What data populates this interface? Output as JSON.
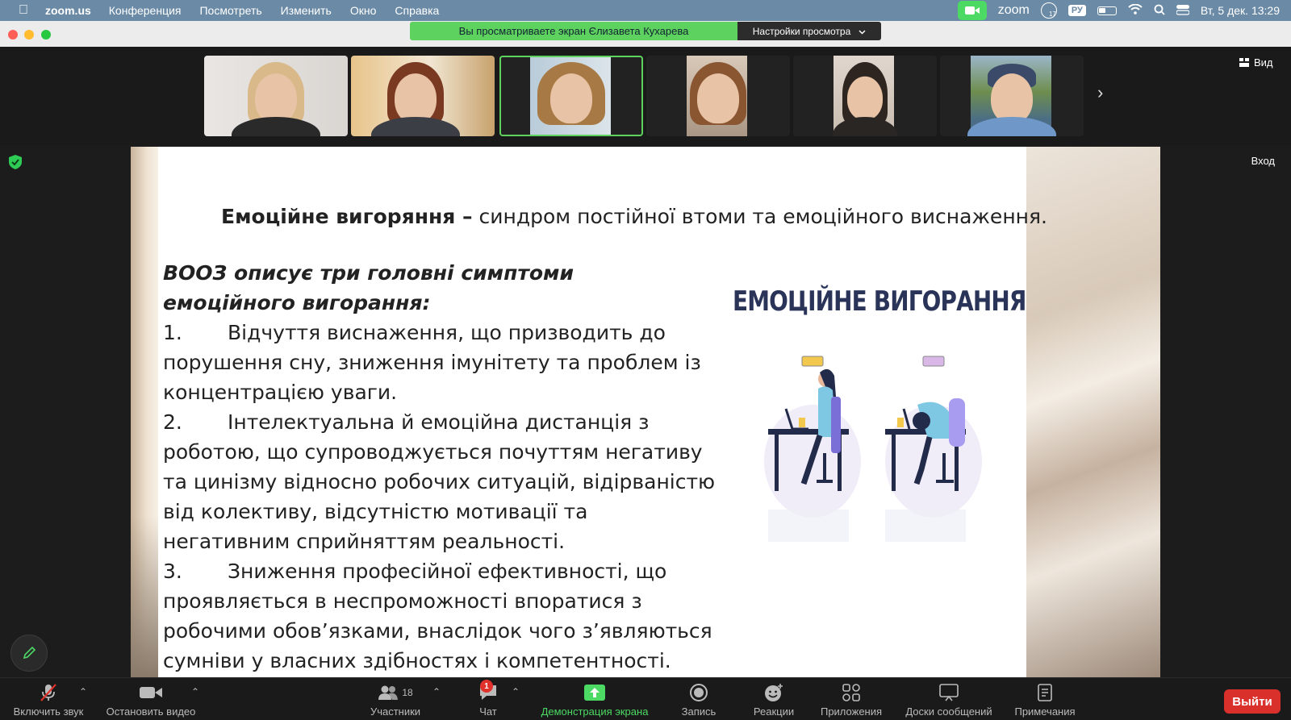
{
  "menubar": {
    "app_name": "zoom.us",
    "items": [
      "Конференция",
      "Посмотреть",
      "Изменить",
      "Окно",
      "Справка"
    ],
    "zoom_label": "zoom",
    "lang": "РУ",
    "calendar_badge": "17",
    "datetime": "Вт, 5 дек.  13:29"
  },
  "share_banner": {
    "viewing_text": "Вы просматриваете экран Єлизавета Кухарева",
    "settings_label": "Настройки просмотра"
  },
  "video_strip": {
    "view_label": "Вид",
    "active_index": 2
  },
  "share_area": {
    "login_label": "Вход"
  },
  "slide": {
    "title_bold": "Емоційне вигоряння –",
    "title_rest": " синдром постійної втоми та емоційного виснаження.",
    "who_heading": "ВООЗ описує три головні симптоми емоційного вигорання:",
    "symptoms": [
      {
        "num": "1.",
        "text": "Відчуття виснаження, що призводить до порушення сну, зниження імунітету та проблем із концентрацією уваги."
      },
      {
        "num": "2.",
        "text": "Інтелектуальна й емоційна дистанція з роботою, що супроводжується почуттям негативу та цинізму відносно робочих ситуацій, відірваністю від колективу, відсутністю мотивації та негативним сприйняттям реальності."
      },
      {
        "num": "3.",
        "text": "Зниження професійної ефективності, що проявляється в неспроможності впоратися з робочими обов’язками, внаслідок чого з’являються сумніви у власних здібностях і компетентності."
      }
    ],
    "illustration_title": "ЕМОЦІЙНЕ ВИГОРАННЯ"
  },
  "toolbar": {
    "unmute": "Включить звук",
    "stop_video": "Остановить видео",
    "participants": "Участники",
    "participants_count": "18",
    "chat": "Чат",
    "chat_badge": "1",
    "share_screen": "Демонстрация экрана",
    "record": "Запись",
    "reactions": "Реакции",
    "apps": "Приложения",
    "whiteboards": "Доски сообщений",
    "notes": "Примечания",
    "leave": "Выйти"
  },
  "colors": {
    "menubar_bg": "#6a8aa6",
    "share_green": "#5ed25e",
    "leave_red": "#d9302c",
    "illustration_title": "#2a3358"
  }
}
